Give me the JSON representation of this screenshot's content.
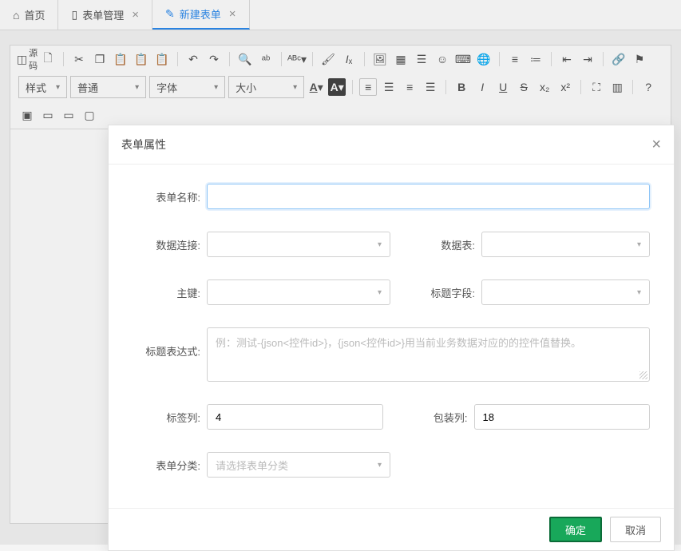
{
  "tabs": {
    "home": "首页",
    "manage": "表单管理",
    "new": "新建表单"
  },
  "toolbar": {
    "source": "源码",
    "style": "样式",
    "format": "普通",
    "font": "字体",
    "size": "大小"
  },
  "modal": {
    "title": "表单属性",
    "labels": {
      "form_name": "表单名称:",
      "data_conn": "数据连接:",
      "data_table": "数据表:",
      "primary_key": "主键:",
      "title_field": "标题字段:",
      "title_expr": "标题表达式:",
      "label_col": "标签列:",
      "wrap_col": "包装列:",
      "category": "表单分类:"
    },
    "placeholders": {
      "title_expr": "例：测试-{json<控件id>}，{json<控件id>}用当前业务数据对应的的控件值替换。",
      "category": "请选择表单分类"
    },
    "values": {
      "label_col": "4",
      "wrap_col": "18"
    },
    "buttons": {
      "ok": "确定",
      "cancel": "取消"
    }
  }
}
